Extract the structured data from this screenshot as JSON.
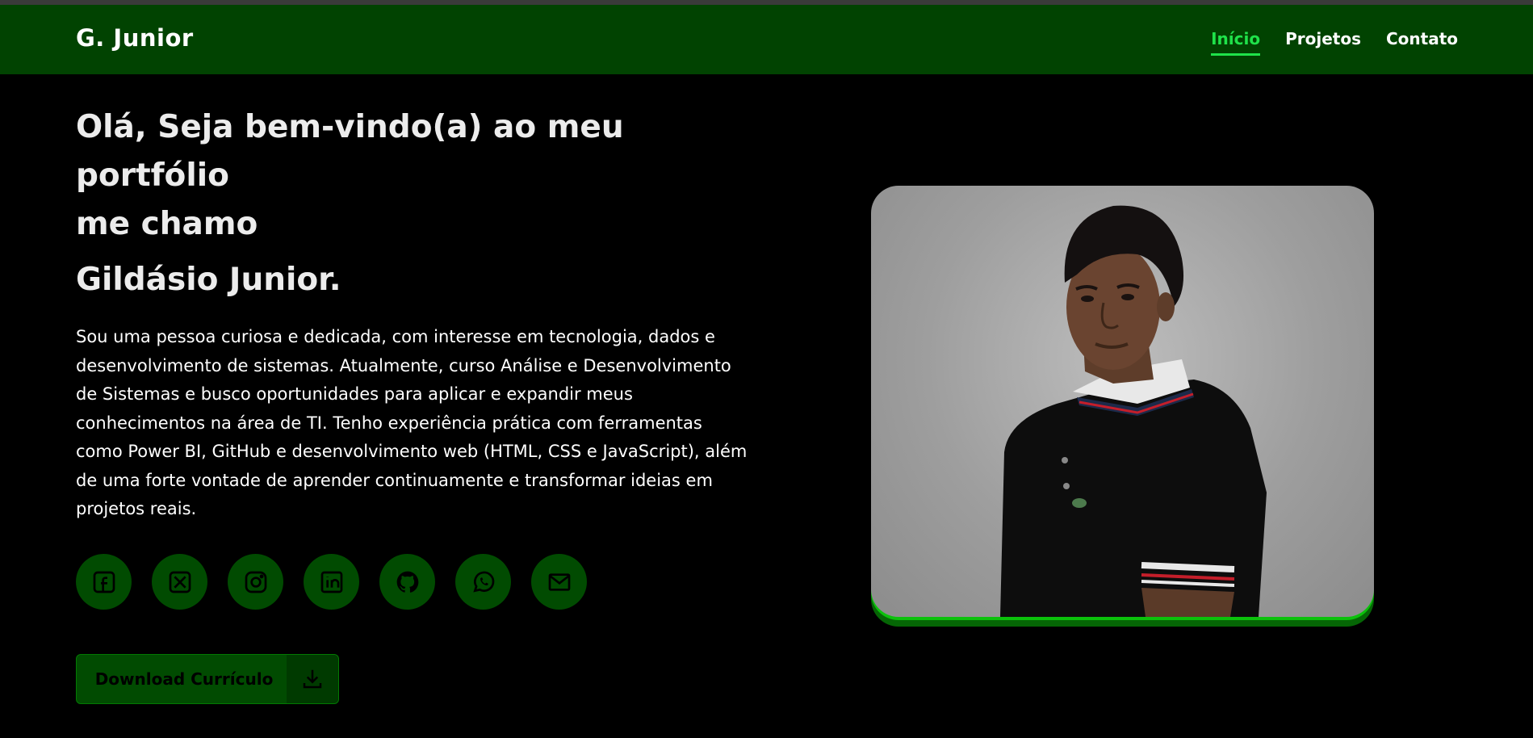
{
  "header": {
    "logo": "G. Junior",
    "nav": [
      {
        "label": "Início",
        "active": true
      },
      {
        "label": "Projetos",
        "active": false
      },
      {
        "label": "Contato",
        "active": false
      }
    ]
  },
  "hero": {
    "line1": "Olá, Seja bem-vindo(a) ao meu",
    "line2": "portfólio",
    "line3": "me chamo",
    "name": "Gildásio Junior.",
    "bio": "Sou uma pessoa curiosa e dedicada, com interesse em tecnologia, dados e desenvolvimento de sistemas. Atualmente, curso Análise e Desenvolvimento de Sistemas e busco oportunidades para aplicar e expandir meus conhecimentos na área de TI. Tenho experiência prática com ferramentas como Power BI, GitHub e desenvolvimento web (HTML, CSS e JavaScript), além de uma forte vontade de aprender continuamente e transformar ideias em projetos reais."
  },
  "socials": [
    "facebook-icon",
    "x-icon",
    "instagram-icon",
    "linkedin-icon",
    "github-icon",
    "whatsapp-icon",
    "mail-icon"
  ],
  "download": {
    "label": "Download Currículo",
    "icon": "download-icon"
  },
  "colors": {
    "header_bg": "#014301",
    "accent": "#1fe24a",
    "button_bg": "#014b01",
    "photo_border": "#0bc10b"
  }
}
